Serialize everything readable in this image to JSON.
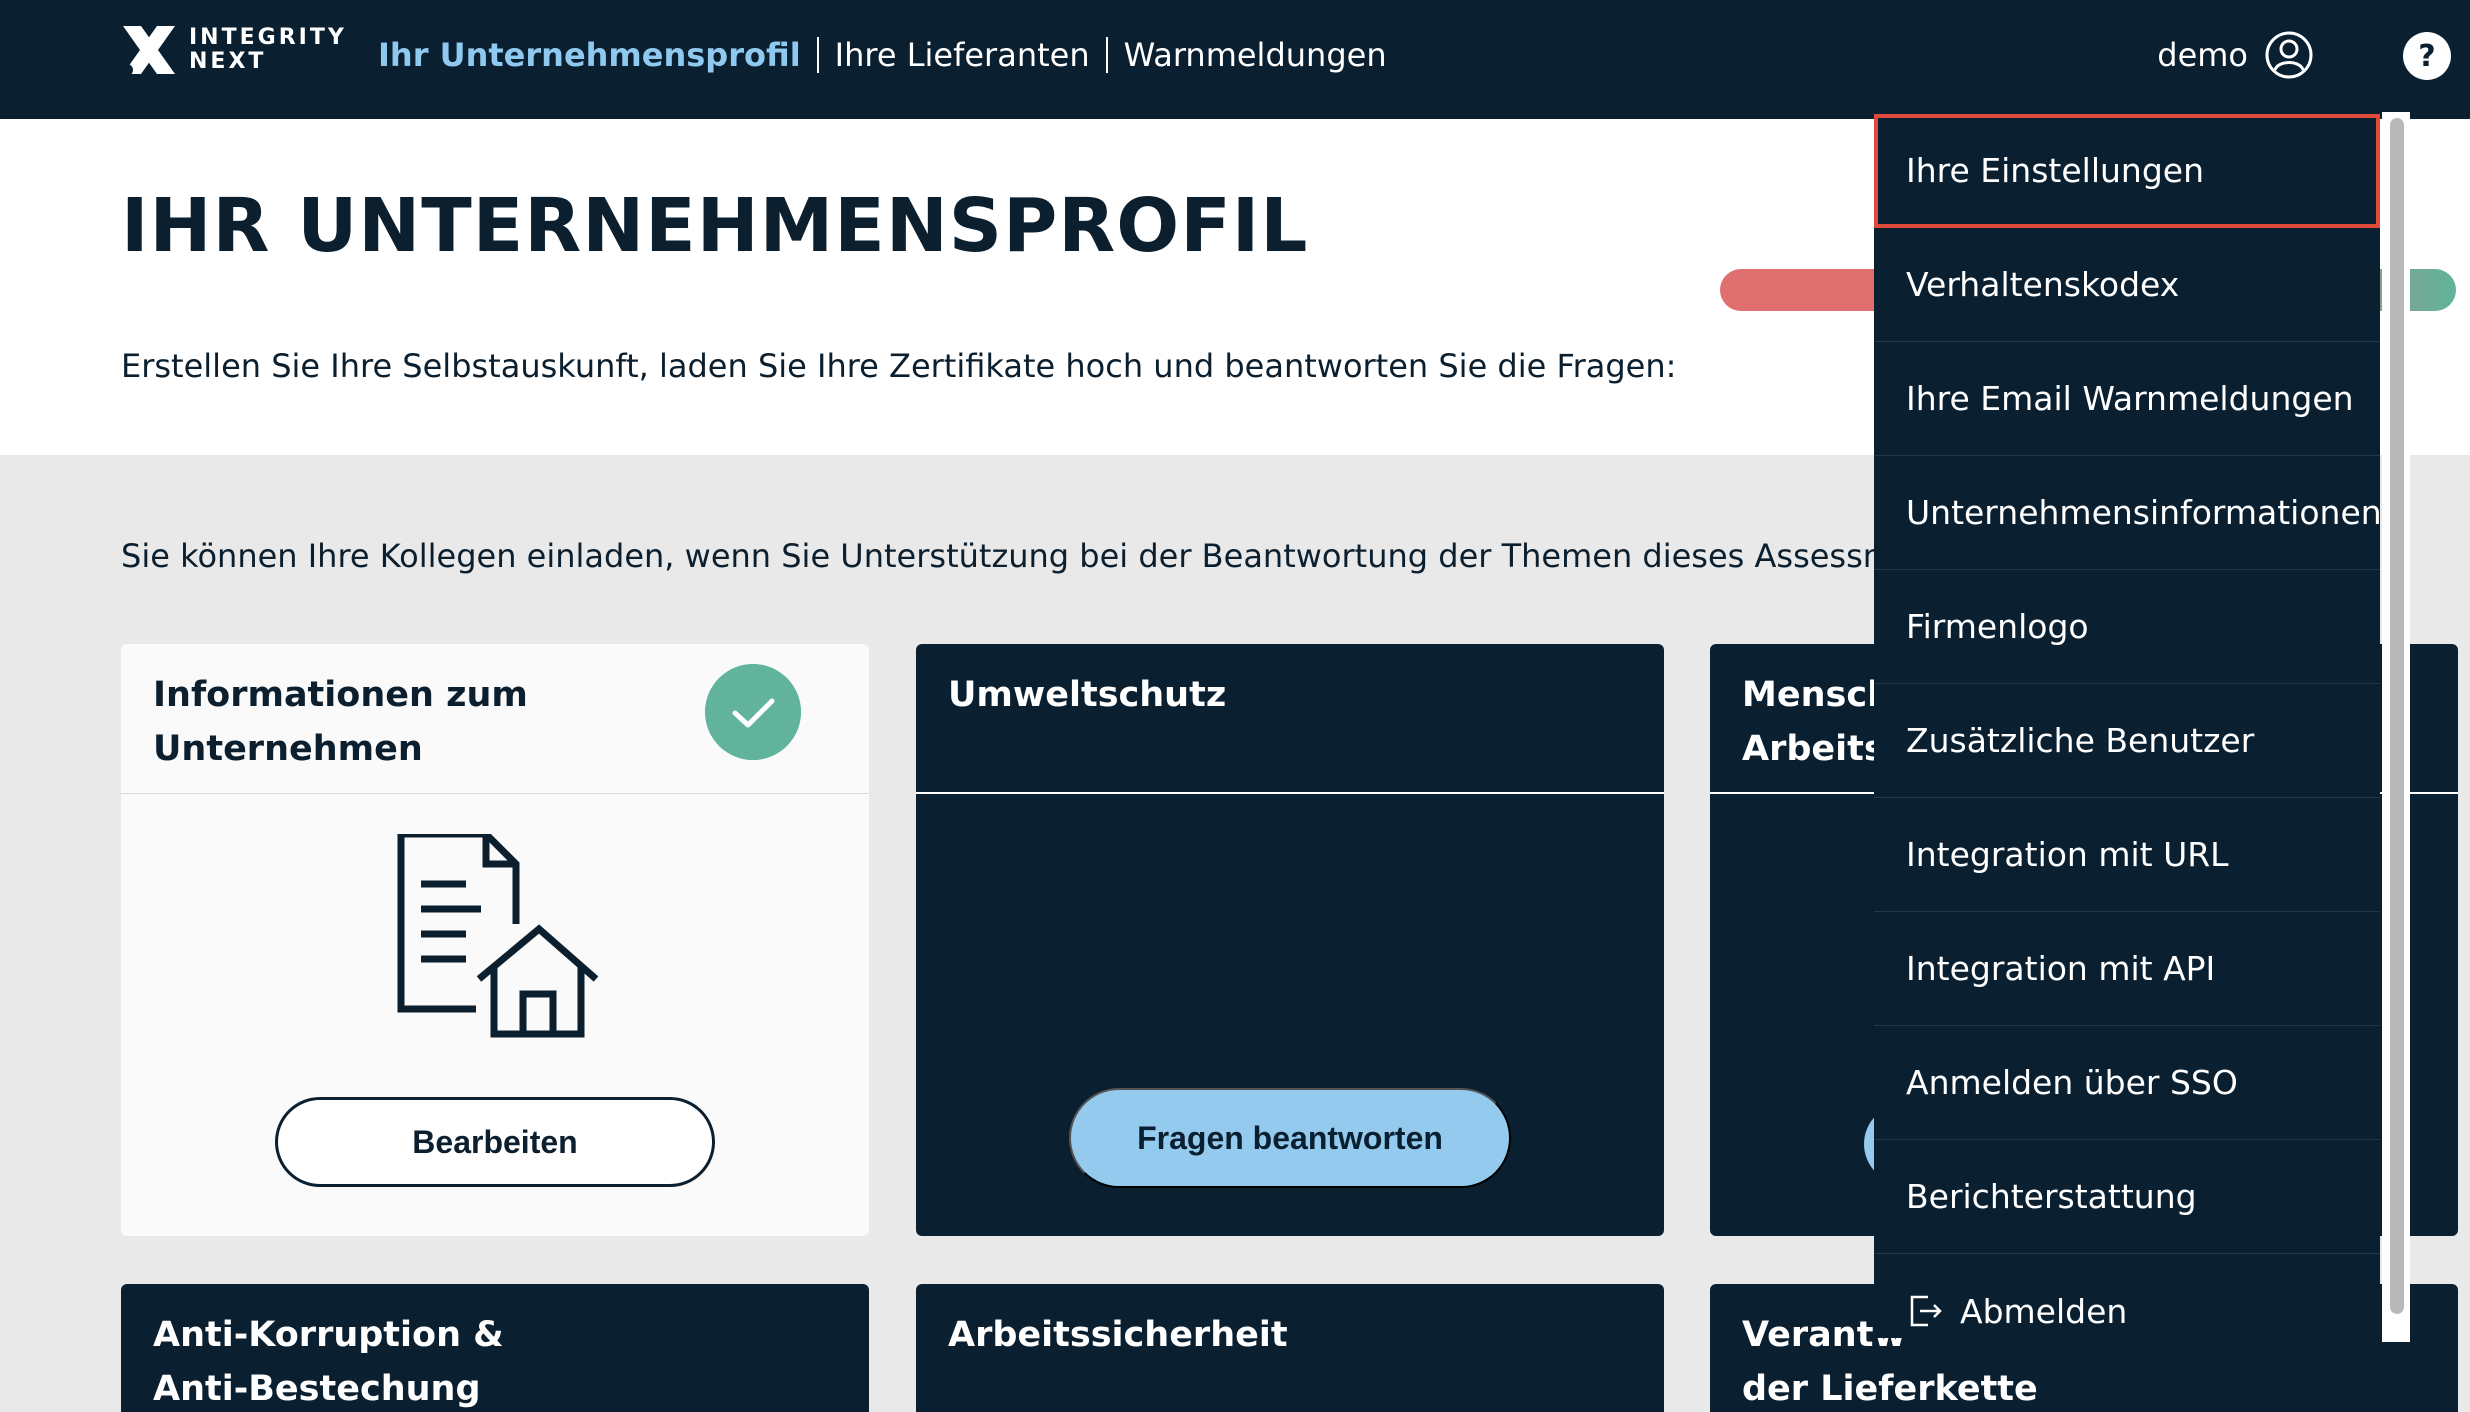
{
  "app": {
    "logo_line1": "INTEGRITY",
    "logo_line2": "NEXT"
  },
  "nav": {
    "items": [
      {
        "label": "Ihr Unternehmensprofil",
        "active": true
      },
      {
        "label": "Ihre Lieferanten",
        "active": false
      },
      {
        "label": "Warnmeldungen",
        "active": false
      }
    ]
  },
  "user": {
    "name": "demo",
    "help_label": "?"
  },
  "header": {
    "title": "IHR UNTERNEHMENSPROFIL",
    "subtitle": "Erstellen Sie Ihre Selbstauskunft, laden Sie Ihre Zertifikate hoch und beantworten Sie die Fragen:"
  },
  "invite_text": "Sie können Ihre Kollegen einladen, wenn Sie Unterstützung bei der Beantwortung der Themen dieses Assessments",
  "cards": [
    {
      "title_line1": "Informationen zum",
      "title_line2": "Unternehmen",
      "button": "Bearbeiten",
      "completed": true
    },
    {
      "title_line1": "Umweltschutz",
      "title_line2": "",
      "button": "Fragen beantworten"
    },
    {
      "title_line1": "Mensch",
      "title_line2": "Arbeits"
    },
    {
      "title_line1": "Anti-Korruption &",
      "title_line2": "Anti-Bestechung"
    },
    {
      "title_line1": "Arbeitssicherheit",
      "title_line2": ""
    },
    {
      "title_line1": "Verantw",
      "title_line2": "der Lieferkette"
    }
  ],
  "dropdown": {
    "items": [
      "Ihre Einstellungen",
      "Verhaltenskodex",
      "Ihre Email Warnmeldungen",
      "Unternehmensinformationen",
      "Firmenlogo",
      "Zusätzliche Benutzer",
      "Integration mit URL",
      "Integration mit API",
      "Anmelden über SSO",
      "Berichterstattung"
    ],
    "logout": "Abmelden"
  },
  "colors": {
    "navy": "#0a1f30",
    "accent_blue": "#94caee",
    "success_green": "#61b39c",
    "progress_red": "#e07070",
    "focus_red": "#e04a3a"
  }
}
